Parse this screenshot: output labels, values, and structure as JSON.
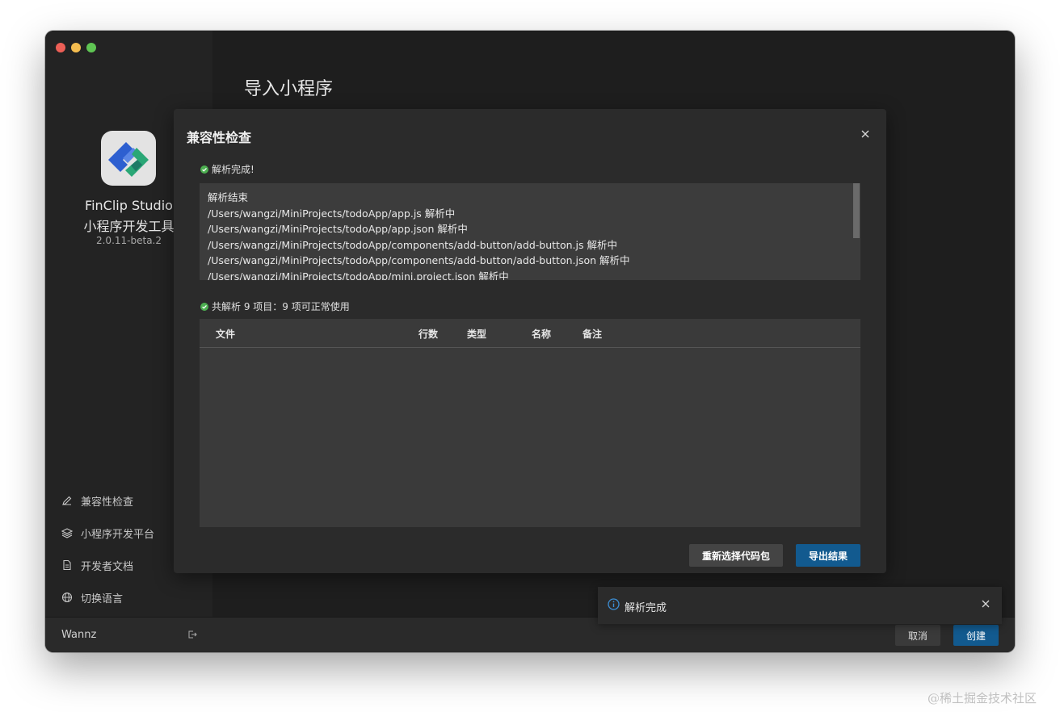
{
  "app": {
    "name_en": "FinClip Studio",
    "name_cn": "小程序开发工具",
    "version": "2.0.11-beta.2"
  },
  "sidebar": {
    "items": [
      {
        "label": "兼容性检查",
        "icon": "pencil-icon"
      },
      {
        "label": "小程序开发平台",
        "icon": "layers-icon"
      },
      {
        "label": "开发者文档",
        "icon": "document-icon"
      },
      {
        "label": "切换语言",
        "icon": "globe-icon"
      }
    ]
  },
  "page": {
    "title": "导入小程序"
  },
  "modal": {
    "title": "兼容性检查",
    "status_parse": "解析完成!",
    "log_lines": [
      "解析结束",
      "/Users/wangzi/MiniProjects/todoApp/app.js 解析中",
      "/Users/wangzi/MiniProjects/todoApp/app.json 解析中",
      "/Users/wangzi/MiniProjects/todoApp/components/add-button/add-button.js 解析中",
      "/Users/wangzi/MiniProjects/todoApp/components/add-button/add-button.json 解析中",
      "/Users/wangzi/MiniProjects/todoApp/mini.project.json 解析中"
    ],
    "summary": "共解析 9 项目：9 项可正常使用",
    "table": {
      "columns": [
        "文件",
        "行数",
        "类型",
        "名称",
        "备注"
      ]
    },
    "reselect_label": "重新选择代码包",
    "export_label": "导出结果"
  },
  "footer": {
    "user": "Wannz",
    "cancel_label": "取消",
    "create_label": "创建"
  },
  "toast": {
    "text": "解析完成"
  },
  "watermark": "@稀土掘金技术社区",
  "colors": {
    "accent": "#125a8f",
    "success": "#4caf50",
    "info": "#3d8fd6"
  }
}
